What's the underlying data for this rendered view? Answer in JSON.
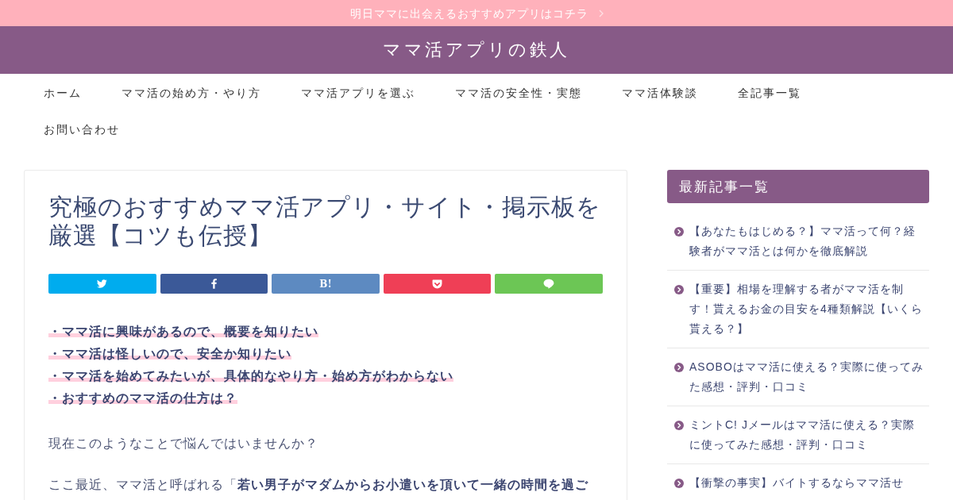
{
  "announcement_bar": {
    "text": "明日ママに出会えるおすすめアプリはコチラ"
  },
  "header": {
    "site_title": "ママ活アプリの鉄人"
  },
  "nav": {
    "items": [
      "ホーム",
      "ママ活の始め方・やり方",
      "ママ活アプリを選ぶ",
      "ママ活の安全性・実態",
      "ママ活体験談",
      "全記事一覧",
      "お問い合わせ"
    ]
  },
  "article": {
    "title": "究極のおすすめママ活アプリ・サイト・掲示板を厳選【コツも伝授】",
    "share_buttons": [
      {
        "kind": "twitter"
      },
      {
        "kind": "facebook"
      },
      {
        "kind": "hatena",
        "label": "B!"
      },
      {
        "kind": "pocket"
      },
      {
        "kind": "line"
      }
    ],
    "checklist": [
      "・ママ活に興味があるので、概要を知りたい",
      "・ママ活は怪しいので、安全か知りたい",
      "・ママ活を始めてみたいが、具体的なやり方・始め方がわからない",
      "・おすすめのママ活の仕方は？"
    ],
    "paragraphs": [
      "現在このようなことで悩んではいませんか？",
      "ここ最近、ママ活と呼ばれる「**若い男子がマダムからお小遣いを頂いて一緒の時間を過ご**"
    ]
  },
  "sidebar": {
    "heading": "最新記事一覧",
    "posts": [
      {
        "title": "【あなたもはじめる？】ママ活って何？経験者がママ活とは何かを徹底解説"
      },
      {
        "title": "【重要】相場を理解する者がママ活を制す！貰えるお金の目安を4種類解説【いくら貰える？】"
      },
      {
        "title": "ASOBOはママ活に使える？実際に使ってみた感想・評判・口コミ"
      },
      {
        "title": "ミントC! Jメールはママ活に使える？実際に使ってみた感想・評判・口コミ"
      },
      {
        "title": "【衝撃の事実】バイトするならママ活せ"
      }
    ]
  }
}
